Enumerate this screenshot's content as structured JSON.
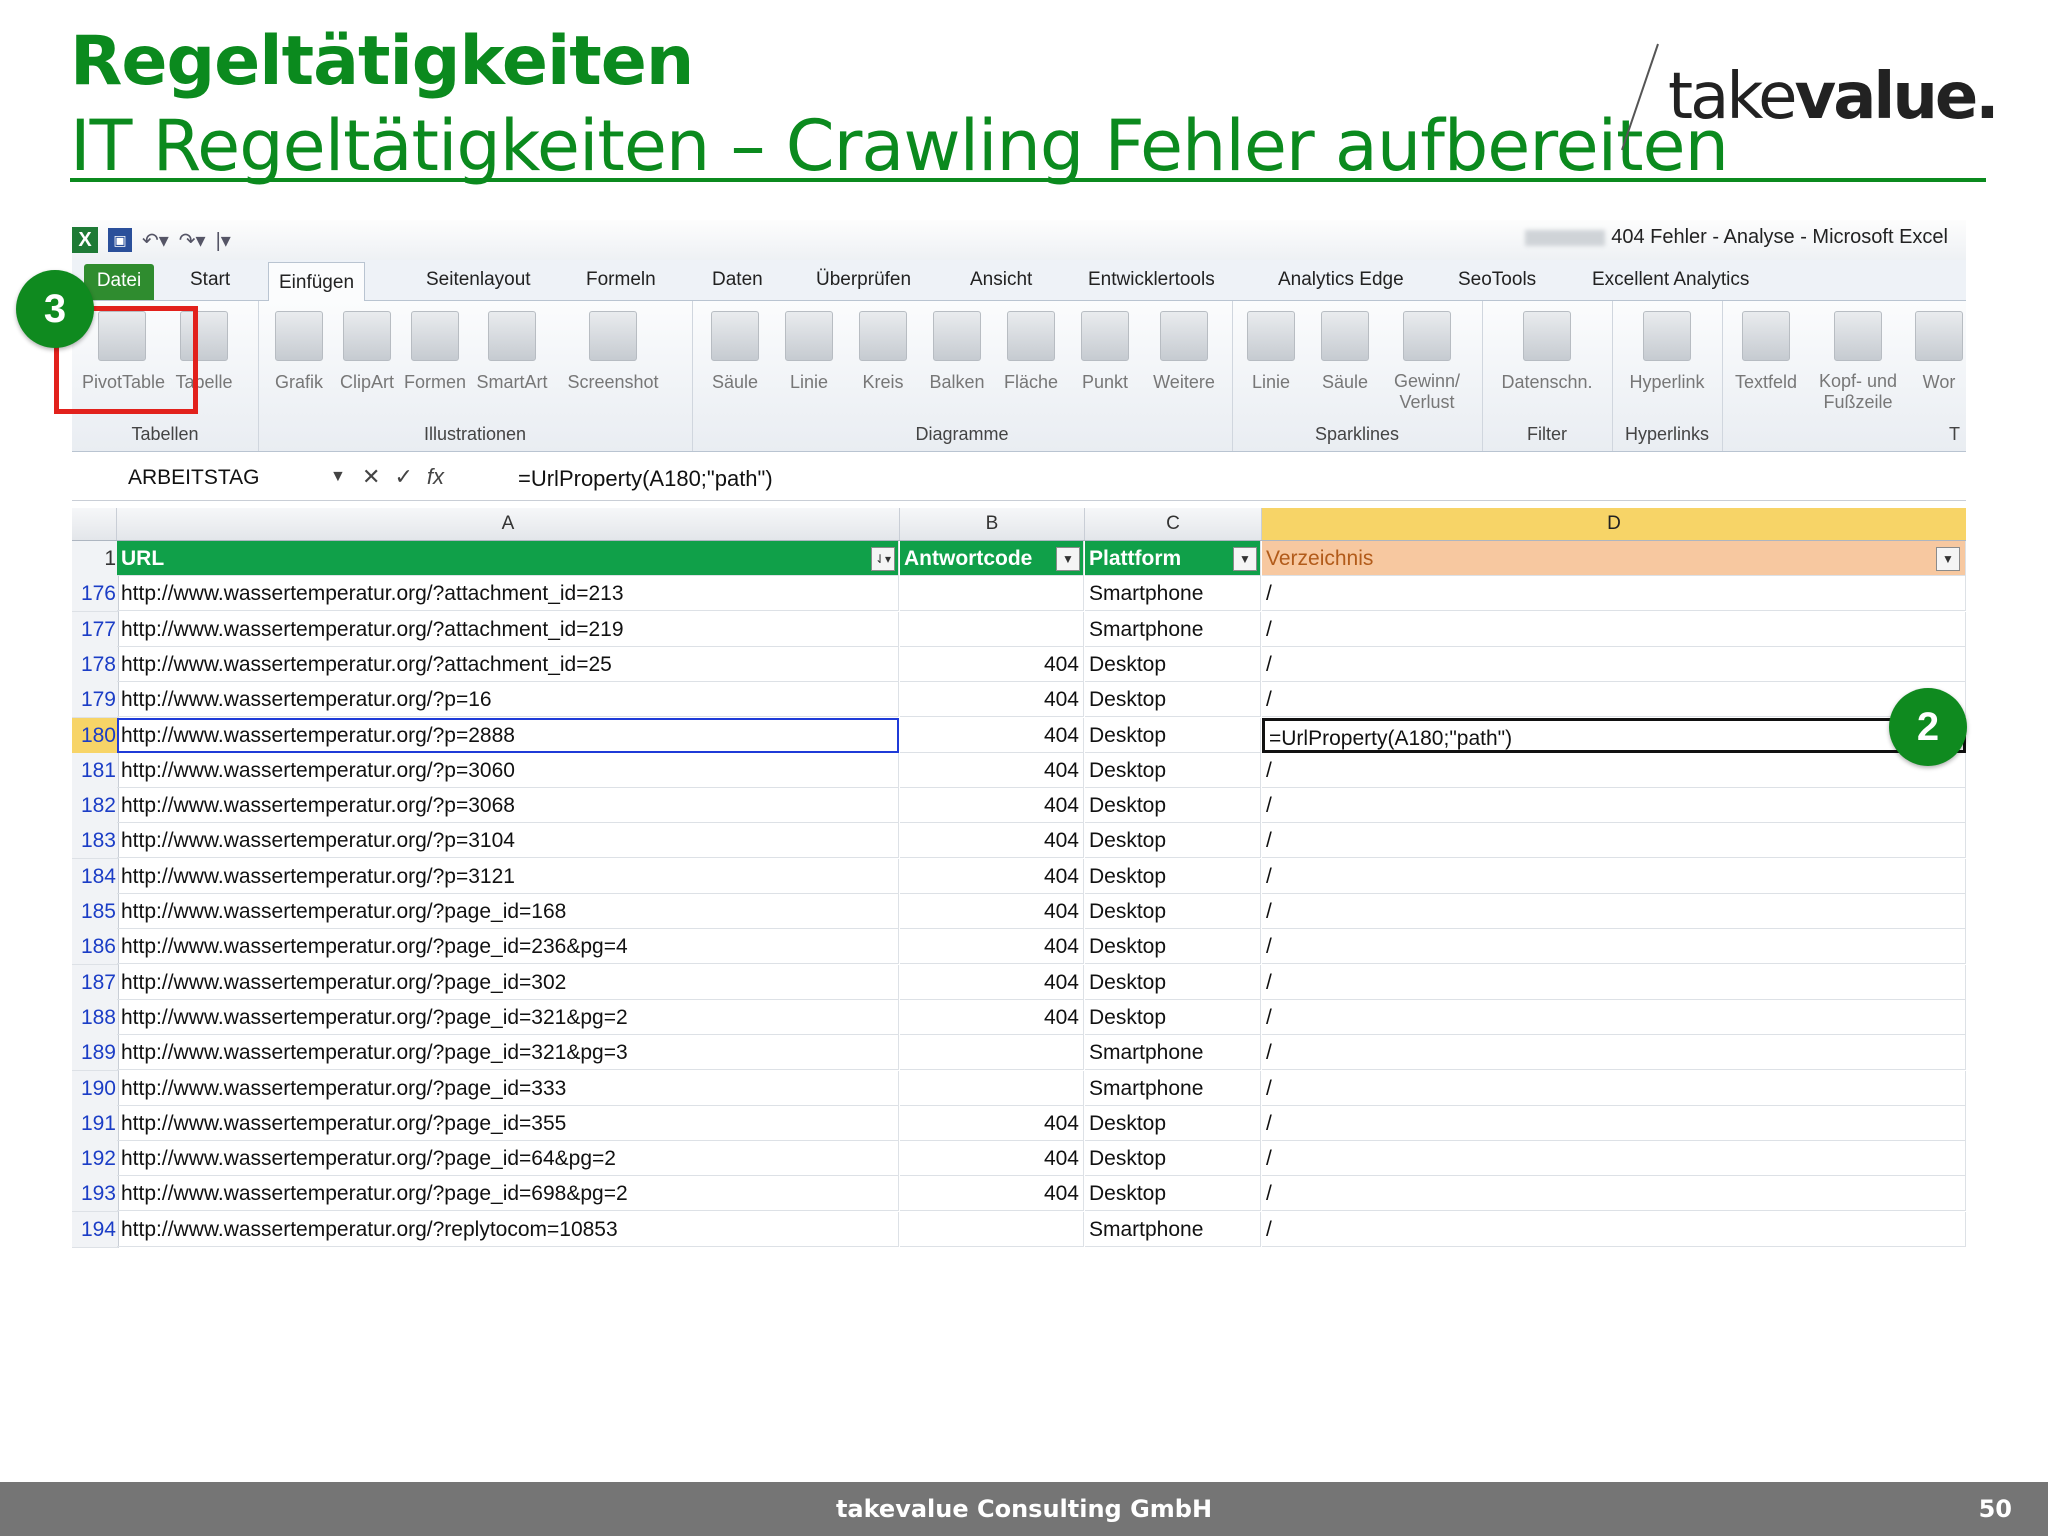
{
  "slide": {
    "title": "Regeltätigkeiten",
    "subtitle": "IT Regeltätigkeiten – Crawling Fehler aufbereiten",
    "logo_part1": "take",
    "logo_part2": "value.",
    "footer": "takevalue Consulting GmbH",
    "page_number": "50"
  },
  "excel": {
    "window_title": "404 Fehler - Analyse -  Microsoft Excel",
    "tabs": [
      "Datei",
      "Start",
      "Einfügen",
      "Seitenlayout",
      "Formeln",
      "Daten",
      "Überprüfen",
      "Ansicht",
      "Entwicklertools",
      "Analytics Edge",
      "SeoTools",
      "Excellent Analytics"
    ],
    "active_tab": "Einfügen",
    "ribbon_groups": [
      {
        "label": "Tabellen",
        "buttons": [
          "PivotTable",
          "Tabelle"
        ]
      },
      {
        "label": "Illustrationen",
        "buttons": [
          "Grafik",
          "ClipArt",
          "Formen",
          "SmartArt",
          "Screenshot"
        ]
      },
      {
        "label": "Diagramme",
        "buttons": [
          "Säule",
          "Linie",
          "Kreis",
          "Balken",
          "Fläche",
          "Punkt",
          "Weitere"
        ]
      },
      {
        "label": "Sparklines",
        "buttons": [
          "Linie",
          "Säule",
          "Gewinn/ Verlust"
        ]
      },
      {
        "label": "Filter",
        "buttons": [
          "Datenschn."
        ]
      },
      {
        "label": "Hyperlinks",
        "buttons": [
          "Hyperlink"
        ]
      },
      {
        "label": "T",
        "buttons": [
          "Textfeld",
          "Kopf- und Fußzeile",
          "Wor"
        ]
      }
    ],
    "name_box": "ARBEITSTAG",
    "formula": "=UrlProperty(A180;\"path\")",
    "columns": [
      "A",
      "B",
      "C",
      "D"
    ],
    "header_row": {
      "num": "1",
      "a": "URL",
      "b": "Antwortcode",
      "c": "Plattform",
      "d": "Verzeichnis"
    },
    "rows": [
      {
        "num": "176",
        "url": "http://www.wassertemperatur.org/?attachment_id=213",
        "code": "",
        "platform": "Smartphone",
        "dir": "/"
      },
      {
        "num": "177",
        "url": "http://www.wassertemperatur.org/?attachment_id=219",
        "code": "",
        "platform": "Smartphone",
        "dir": "/"
      },
      {
        "num": "178",
        "url": "http://www.wassertemperatur.org/?attachment_id=25",
        "code": "404",
        "platform": "Desktop",
        "dir": "/"
      },
      {
        "num": "179",
        "url": "http://www.wassertemperatur.org/?p=16",
        "code": "404",
        "platform": "Desktop",
        "dir": "/"
      },
      {
        "num": "180",
        "url": "http://www.wassertemperatur.org/?p=2888",
        "code": "404",
        "platform": "Desktop",
        "dir": "=UrlProperty(A180;\"path\")"
      },
      {
        "num": "181",
        "url": "http://www.wassertemperatur.org/?p=3060",
        "code": "404",
        "platform": "Desktop",
        "dir": "/"
      },
      {
        "num": "182",
        "url": "http://www.wassertemperatur.org/?p=3068",
        "code": "404",
        "platform": "Desktop",
        "dir": "/"
      },
      {
        "num": "183",
        "url": "http://www.wassertemperatur.org/?p=3104",
        "code": "404",
        "platform": "Desktop",
        "dir": "/"
      },
      {
        "num": "184",
        "url": "http://www.wassertemperatur.org/?p=3121",
        "code": "404",
        "platform": "Desktop",
        "dir": "/"
      },
      {
        "num": "185",
        "url": "http://www.wassertemperatur.org/?page_id=168",
        "code": "404",
        "platform": "Desktop",
        "dir": "/"
      },
      {
        "num": "186",
        "url": "http://www.wassertemperatur.org/?page_id=236&pg=4",
        "code": "404",
        "platform": "Desktop",
        "dir": "/"
      },
      {
        "num": "187",
        "url": "http://www.wassertemperatur.org/?page_id=302",
        "code": "404",
        "platform": "Desktop",
        "dir": "/"
      },
      {
        "num": "188",
        "url": "http://www.wassertemperatur.org/?page_id=321&pg=2",
        "code": "404",
        "platform": "Desktop",
        "dir": "/"
      },
      {
        "num": "189",
        "url": "http://www.wassertemperatur.org/?page_id=321&pg=3",
        "code": "",
        "platform": "Smartphone",
        "dir": "/"
      },
      {
        "num": "190",
        "url": "http://www.wassertemperatur.org/?page_id=333",
        "code": "",
        "platform": "Smartphone",
        "dir": "/"
      },
      {
        "num": "191",
        "url": "http://www.wassertemperatur.org/?page_id=355",
        "code": "404",
        "platform": "Desktop",
        "dir": "/"
      },
      {
        "num": "192",
        "url": "http://www.wassertemperatur.org/?page_id=64&pg=2",
        "code": "404",
        "platform": "Desktop",
        "dir": "/"
      },
      {
        "num": "193",
        "url": "http://www.wassertemperatur.org/?page_id=698&pg=2",
        "code": "404",
        "platform": "Desktop",
        "dir": "/"
      },
      {
        "num": "194",
        "url": "http://www.wassertemperatur.org/?replytocom=10853",
        "code": "",
        "platform": "Smartphone",
        "dir": "/"
      }
    ]
  },
  "badges": {
    "step2": "2",
    "step3": "3"
  },
  "colors": {
    "brand_green": "#0b8a1e",
    "header_green": "#10a049",
    "highlight_red": "#e2211c",
    "footer_gray": "#757575"
  }
}
